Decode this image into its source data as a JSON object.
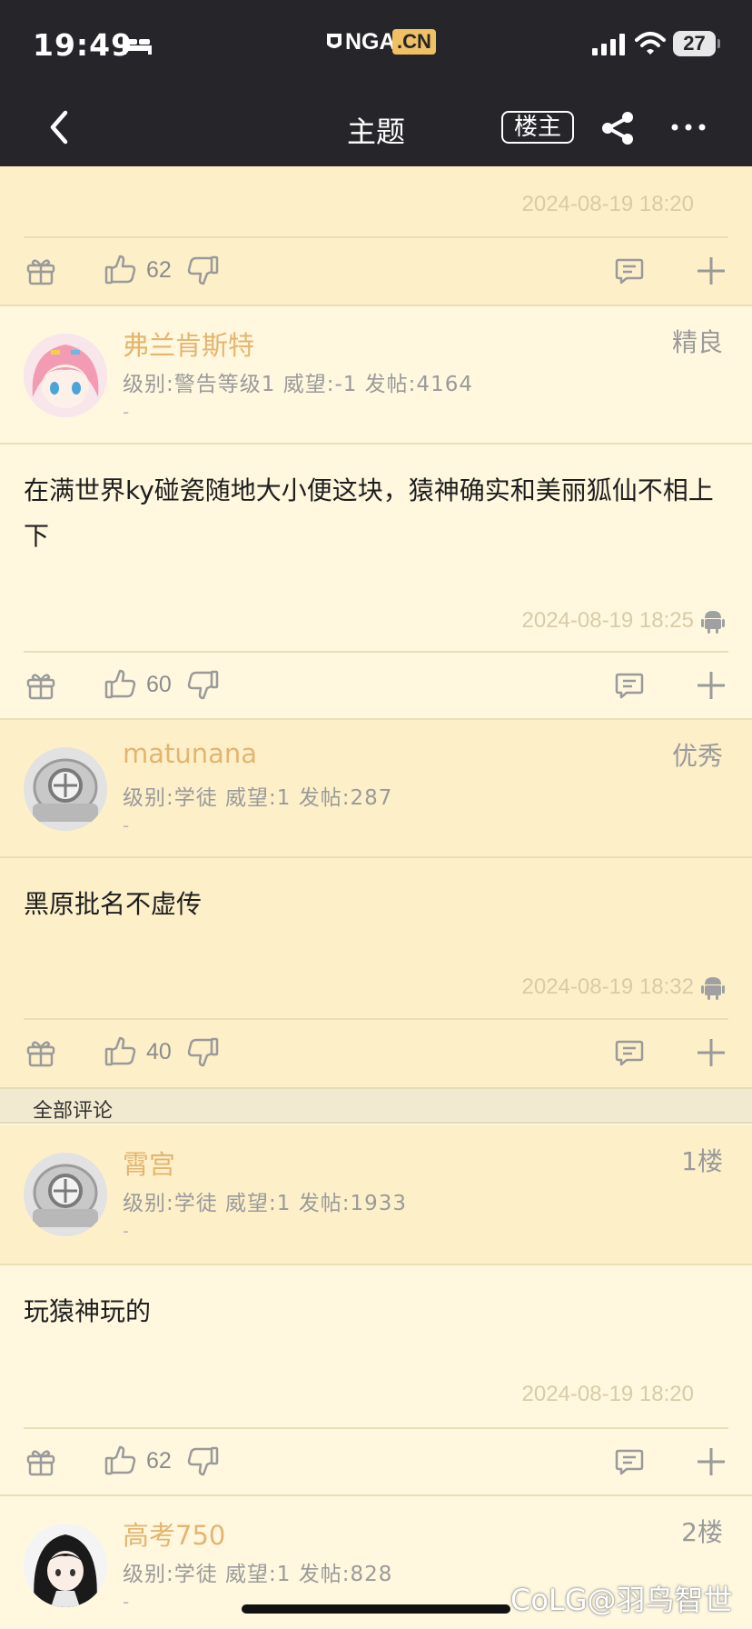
{
  "status_bar": {
    "time": "19:49",
    "battery": "27"
  },
  "logo": {
    "brand": "NGA",
    "tld": ".CN"
  },
  "nav": {
    "title": "主题",
    "op_label": "楼主"
  },
  "colors": {
    "topbar": "#26262a",
    "username": "#e3b56f",
    "page_bg": "#fdf6dc",
    "logo_accent": "#f0c064"
  },
  "top_partial": {
    "timestamp": "2024-08-19 18:20",
    "likes": "62"
  },
  "posts": [
    {
      "username": "弗兰肯斯特",
      "meta": "级别:警告等级1  威望:-1  发帖:4164",
      "signature": "-",
      "badge": "精良",
      "content": "在满世界ky碰瓷随地大小便这块，猿神确实和美丽狐仙不相上下",
      "timestamp": "2024-08-19 18:25",
      "likes": "60",
      "platform_icon": "android-icon"
    },
    {
      "username": "matunana",
      "meta": "级别:学徒  威望:1  发帖:287",
      "signature": "-",
      "badge": "优秀",
      "content": "黑原批名不虚传",
      "timestamp": "2024-08-19 18:32",
      "likes": "40",
      "platform_icon": "android-icon"
    }
  ],
  "section_label": "全部评论",
  "replies": [
    {
      "username": "霄宫",
      "meta": "级别:学徒  威望:1  发帖:1933",
      "signature": "-",
      "floor": "1楼",
      "content": "玩猿神玩的",
      "timestamp": "2024-08-19 18:20",
      "likes": "62"
    },
    {
      "username": "高考750",
      "meta": "级别:学徒  威望:1  发帖:828",
      "signature": "-",
      "floor": "2楼"
    }
  ],
  "watermark": "CoLG@羽鸟智世"
}
